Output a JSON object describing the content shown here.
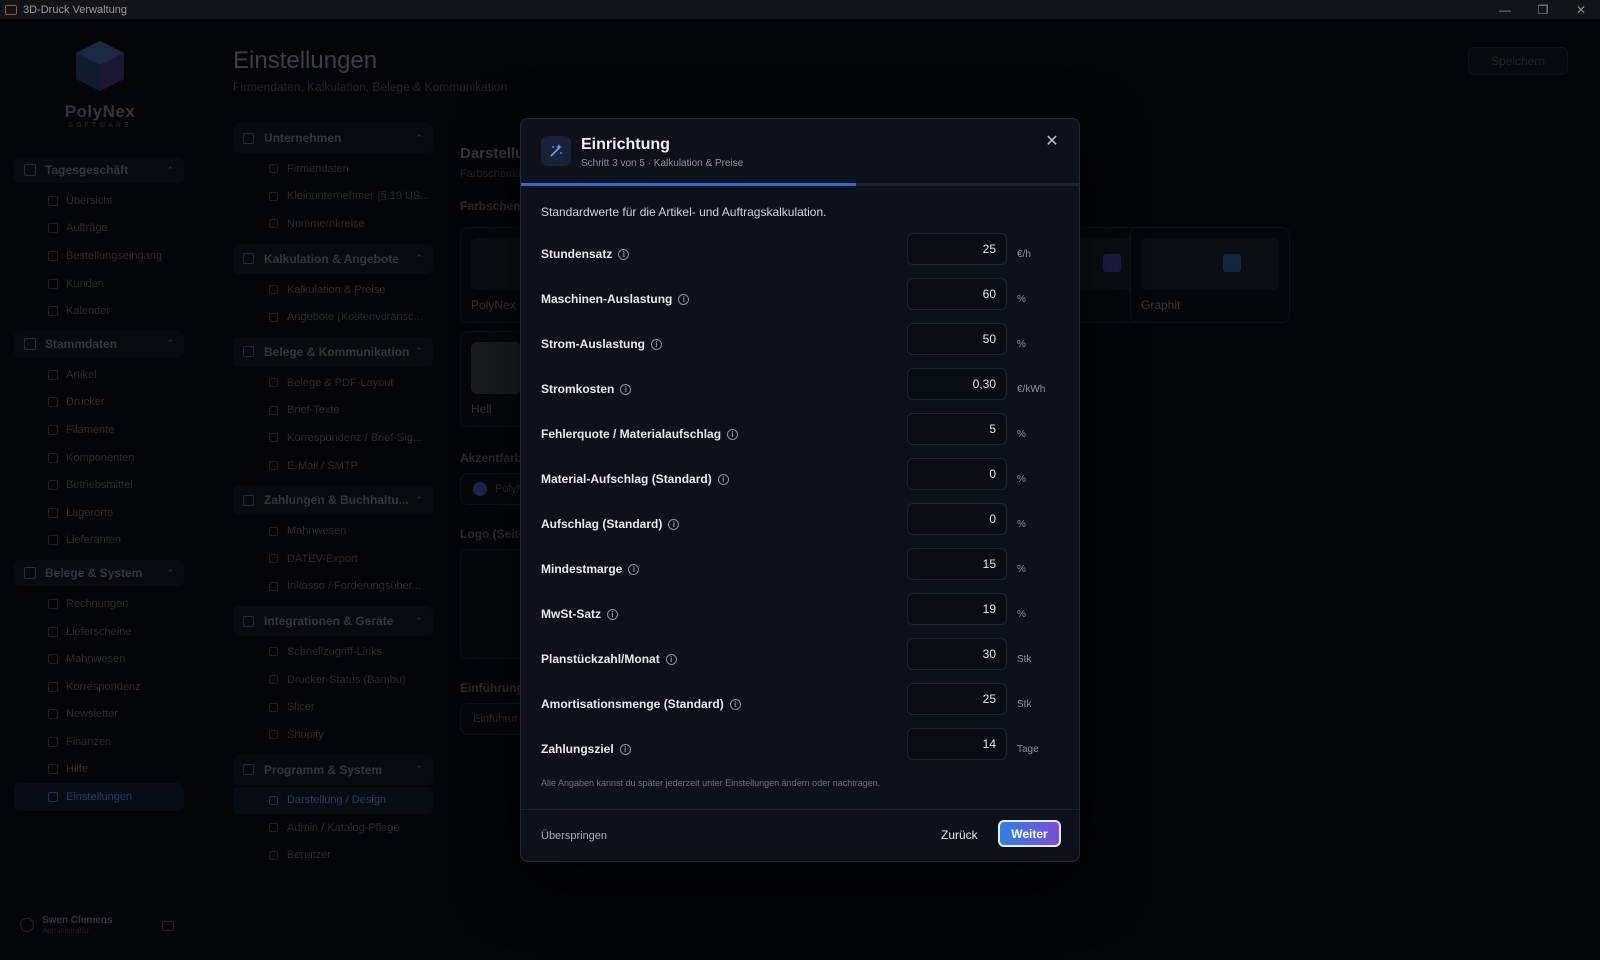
{
  "window": {
    "title": "3D-Druck Verwaltung"
  },
  "brand": {
    "name": "PolyNex",
    "sub": "SOFTWARE"
  },
  "sidebar": {
    "groups": [
      {
        "label": "Tagesgeschäft",
        "items": [
          "Übersicht",
          "Aufträge",
          "Bestellungseingang",
          "Kunden",
          "Kalender"
        ]
      },
      {
        "label": "Stammdaten",
        "items": [
          "Artikel",
          "Drucker",
          "Filamente",
          "Komponenten",
          "Betriebsmittel",
          "Lagerorte",
          "Lieferanten"
        ]
      },
      {
        "label": "Belege & System",
        "items": [
          "Rechnungen",
          "Lieferscheine",
          "Mahnwesen",
          "Korrespondenz",
          "Newsletter",
          "Finanzen",
          "Hilfe",
          "Einstellungen"
        ]
      }
    ],
    "user": {
      "name": "Swen Clemens",
      "role": "Administrator"
    }
  },
  "page": {
    "title": "Einstellungen",
    "subtitle": "Firmendaten, Kalkulation, Belege & Kommunikation",
    "save_label": "Speichern"
  },
  "settings_nav": [
    {
      "label": "Unternehmen",
      "items": [
        "Firmendaten",
        "Kleinunternehmer (§ 19 US...",
        "Nummernkreise"
      ]
    },
    {
      "label": "Kalkulation & Angebote",
      "items": [
        "Kalkulation & Preise",
        "Angebote (Kostenvoransc..."
      ]
    },
    {
      "label": "Belege & Kommunikation",
      "items": [
        "Belege & PDF-Layout",
        "Brief-Texte",
        "Korrespondenz / Brief-Sig...",
        "E-Mail / SMTP"
      ]
    },
    {
      "label": "Zahlungen & Buchhaltu...",
      "items": [
        "Mahnwesen",
        "DATEV-Export",
        "Inkasso / Forderungsüber..."
      ]
    },
    {
      "label": "Integrationen & Geräte",
      "items": [
        "Schnellzugriff-Links",
        "Drucker-Status (Bambu)",
        "Slicer",
        "Shopify"
      ]
    },
    {
      "label": "Programm & System",
      "items": [
        "Darstellung / Design",
        "Admin / Katalog-Pflege",
        "Benutzer"
      ]
    }
  ],
  "content": {
    "title": "Darstellu",
    "subtitle": "Farbschema",
    "scheme_label": "Farbschema",
    "themes": [
      "PolyNex",
      "Hell",
      "Graphit"
    ],
    "accent_label": "Akzentfarbe",
    "accent_value": "PolyN",
    "logo_label": "Logo (Seite",
    "intro_label": "Einführung",
    "intro_value": "Einführur"
  },
  "modal": {
    "title": "Einrichtung",
    "step": "Schritt 3 von 5 · Kalkulation & Preise",
    "progress": 0.6,
    "intro": "Standardwerte für die Artikel- und Auftragskalkulation.",
    "fields": [
      {
        "label": "Stundensatz",
        "value": "25",
        "unit": "€/h"
      },
      {
        "label": "Maschinen-Auslastung",
        "value": "60",
        "unit": "%"
      },
      {
        "label": "Strom-Auslastung",
        "value": "50",
        "unit": "%"
      },
      {
        "label": "Stromkosten",
        "value": "0,30",
        "unit": "€/kWh"
      },
      {
        "label": "Fehlerquote / Materialaufschlag",
        "value": "5",
        "unit": "%"
      },
      {
        "label": "Material-Aufschlag (Standard)",
        "value": "0",
        "unit": "%"
      },
      {
        "label": "Aufschlag (Standard)",
        "value": "0",
        "unit": "%"
      },
      {
        "label": "Mindestmarge",
        "value": "15",
        "unit": "%"
      },
      {
        "label": "MwSt-Satz",
        "value": "19",
        "unit": "%"
      },
      {
        "label": "Planstückzahl/Monat",
        "value": "30",
        "unit": "Stk"
      },
      {
        "label": "Amortisationsmenge (Standard)",
        "value": "25",
        "unit": "Stk"
      },
      {
        "label": "Zahlungsziel",
        "value": "14",
        "unit": "Tage"
      }
    ],
    "note": "Alle Angaben kannst du später jederzeit unter Einstellungen ändern oder nachtragen.",
    "skip_label": "Überspringen",
    "back_label": "Zurück",
    "next_label": "Weiter"
  },
  "colors": {
    "accent": "#3567d8",
    "next_start": "#2f7fe0",
    "next_end": "#7a4fd8"
  }
}
